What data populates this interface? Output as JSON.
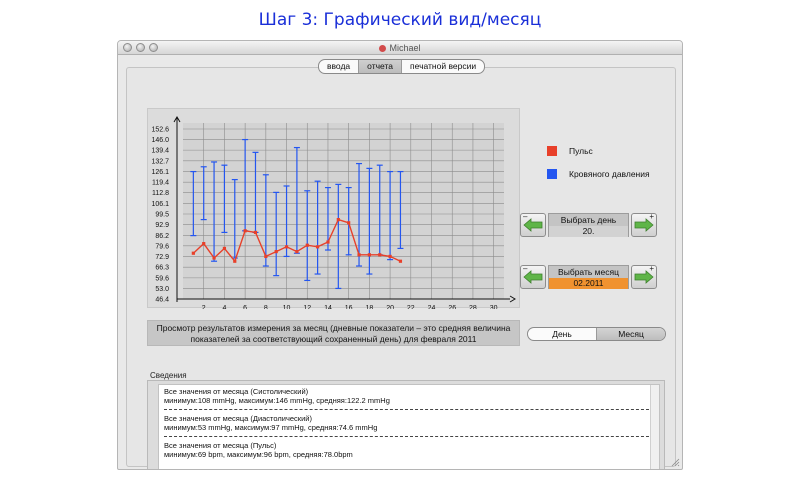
{
  "page_heading": "Шаг 3: Графический вид/месяц",
  "window": {
    "title": "Michael"
  },
  "tabs": [
    {
      "label": "ввода",
      "active": false
    },
    {
      "label": "отчета",
      "active": true
    },
    {
      "label": "печатной версии",
      "active": false
    }
  ],
  "legend": [
    {
      "label": "Пульс",
      "color": "#e8402a"
    },
    {
      "label": "Кровяного давления",
      "color": "#2456f0"
    }
  ],
  "day_selector": {
    "label": "Выбрать день",
    "value": "20."
  },
  "month_selector": {
    "label": "Выбрать месяц",
    "value": "02.2011"
  },
  "description": "Просмотр результатов измерения за месяц (дневные показатели – это средняя величина показателей за соответствующий сохраненный день) для февраля 2011",
  "view_toggle": [
    {
      "label": "День",
      "active": false
    },
    {
      "label": "Месяц",
      "active": true
    }
  ],
  "info": {
    "group_label": "Сведения",
    "blocks": [
      {
        "title": "Все значения от месяца (Систолический)",
        "detail": "минимум:108 mmHg, максимум:146 mmHg, средняя:122.2 mmHg"
      },
      {
        "title": "Все значения от месяца (Диастолический)",
        "detail": "минимум:53 mmHg, максимум:97 mmHg, средняя:74.6 mmHg"
      },
      {
        "title": "Все значения от месяца (Пульс)",
        "detail": "минимум:69 bpm, максимум:96 bpm, средняя:78.0bpm"
      }
    ]
  },
  "chart_data": {
    "type": "line",
    "title": "",
    "xlabel": "",
    "ylabel": "",
    "x_ticks": [
      2,
      4,
      6,
      8,
      10,
      12,
      14,
      16,
      18,
      20,
      22,
      24,
      26,
      28,
      30
    ],
    "y_ticks": [
      "46.4",
      "53.0",
      "59.6",
      "66.3",
      "72.9",
      "79.6",
      "86.2",
      "92.9",
      "99.5",
      "106.1",
      "112.8",
      "119.4",
      "126.1",
      "132.7",
      "139.4",
      "146.0",
      "152.6"
    ],
    "xlim": [
      0,
      31
    ],
    "ylim": [
      46.4,
      152.6
    ],
    "grid": true,
    "colors": {
      "pulse": "#e8402a",
      "pressure": "#2456f0"
    },
    "series": [
      {
        "name": "Кровяного давления",
        "kind": "range",
        "points": [
          {
            "day": 1,
            "low": 86,
            "high": 126
          },
          {
            "day": 2,
            "low": 96,
            "high": 129
          },
          {
            "day": 3,
            "low": 70,
            "high": 132
          },
          {
            "day": 4,
            "low": 88,
            "high": 130
          },
          {
            "day": 5,
            "low": 72,
            "high": 121
          },
          {
            "day": 6,
            "low": 89,
            "high": 146
          },
          {
            "day": 7,
            "low": 88,
            "high": 138
          },
          {
            "day": 8,
            "low": 67,
            "high": 124
          },
          {
            "day": 9,
            "low": 61,
            "high": 113
          },
          {
            "day": 10,
            "low": 73,
            "high": 117
          },
          {
            "day": 11,
            "low": 75,
            "high": 141
          },
          {
            "day": 12,
            "low": 58,
            "high": 114
          },
          {
            "day": 13,
            "low": 62,
            "high": 120
          },
          {
            "day": 14,
            "low": 77,
            "high": 116
          },
          {
            "day": 15,
            "low": 53,
            "high": 118
          },
          {
            "day": 16,
            "low": 74,
            "high": 116
          },
          {
            "day": 17,
            "low": 67,
            "high": 131
          },
          {
            "day": 18,
            "low": 62,
            "high": 128
          },
          {
            "day": 19,
            "low": 74,
            "high": 130
          },
          {
            "day": 20,
            "low": 71,
            "high": 126
          },
          {
            "day": 21,
            "low": 78,
            "high": 126
          }
        ]
      },
      {
        "name": "Пульс",
        "kind": "line",
        "points": [
          {
            "day": 1,
            "value": 75
          },
          {
            "day": 2,
            "value": 81
          },
          {
            "day": 3,
            "value": 72
          },
          {
            "day": 4,
            "value": 78
          },
          {
            "day": 5,
            "value": 70
          },
          {
            "day": 6,
            "value": 89
          },
          {
            "day": 7,
            "value": 88
          },
          {
            "day": 8,
            "value": 73
          },
          {
            "day": 9,
            "value": 76
          },
          {
            "day": 10,
            "value": 79
          },
          {
            "day": 11,
            "value": 76
          },
          {
            "day": 12,
            "value": 80
          },
          {
            "day": 13,
            "value": 79
          },
          {
            "day": 14,
            "value": 82
          },
          {
            "day": 15,
            "value": 96
          },
          {
            "day": 16,
            "value": 94
          },
          {
            "day": 17,
            "value": 74
          },
          {
            "day": 18,
            "value": 74
          },
          {
            "day": 19,
            "value": 74
          },
          {
            "day": 20,
            "value": 73
          },
          {
            "day": 21,
            "value": 70
          }
        ]
      }
    ]
  }
}
